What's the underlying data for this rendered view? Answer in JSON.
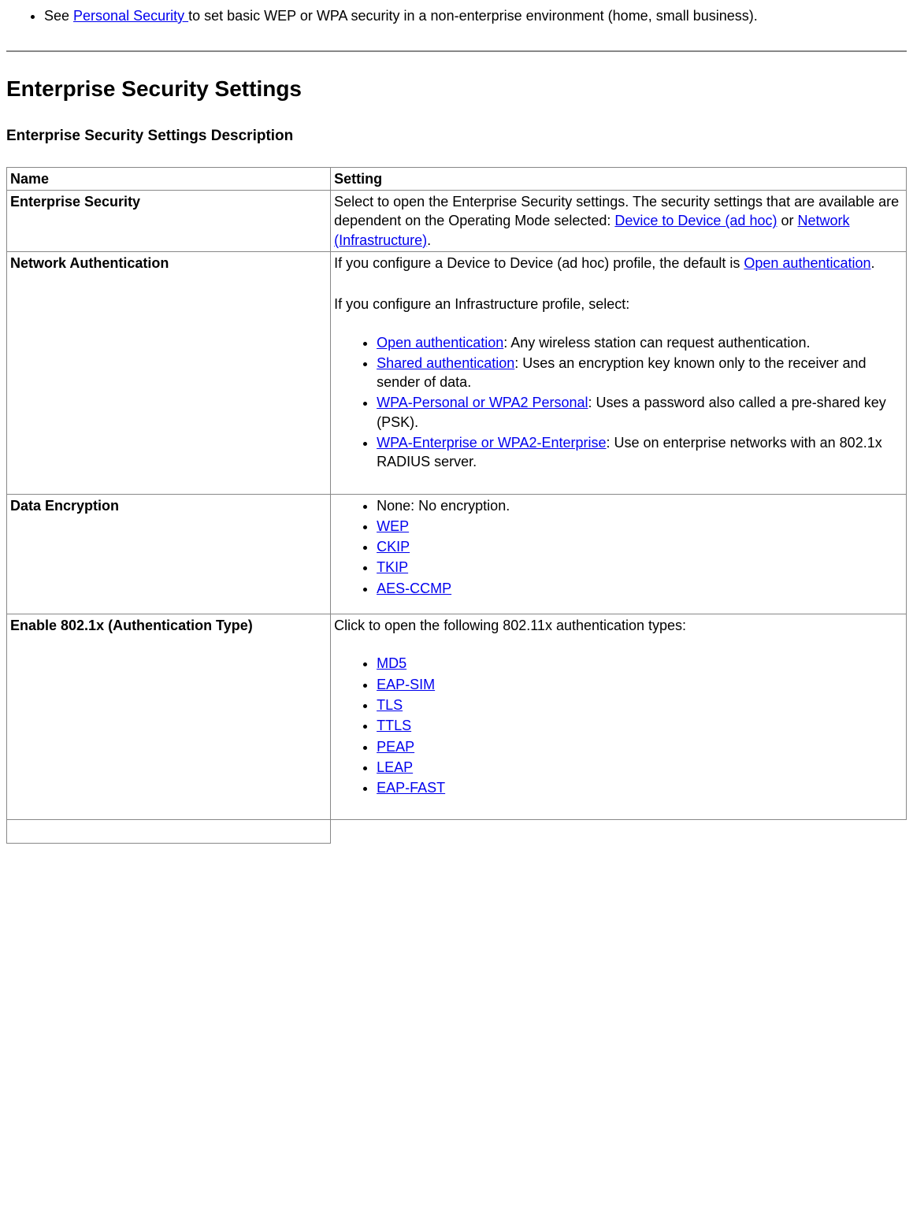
{
  "top_note": {
    "prefix": "See ",
    "link": "Personal Security ",
    "suffix": "to set basic WEP or WPA security in a non-enterprise environment (home, small business)."
  },
  "heading": "Enterprise Security Settings",
  "subheading": "Enterprise Security Settings Description",
  "table": {
    "headers": {
      "name": "Name",
      "setting": "Setting"
    },
    "rows": {
      "r1": {
        "name": "Enterprise Security",
        "setting_parts": {
          "p1a": "Select to open the Enterprise Security settings. The security settings that are available are dependent on the Operating Mode selected: ",
          "link1": "Device to Device (ad hoc)",
          "p1b": " or ",
          "link2": "Network (Infrastructure)",
          "p1c": "."
        }
      },
      "r2": {
        "name": "Network Authentication",
        "intro1a": "If you configure a Device to Device (ad hoc) profile, the default is ",
        "intro1_link": "Open authentication",
        "intro1b": ".",
        "intro2": "If you configure an Infrastructure profile, select:",
        "items": {
          "i1": {
            "link": "Open authentication",
            "suffix": ": Any wireless station can request authentication."
          },
          "i2": {
            "link": "Shared authentication",
            "suffix": ": Uses an encryption key known only to the receiver and sender of data."
          },
          "i3": {
            "link": "WPA-Personal or WPA2 Personal",
            "suffix": ": Uses a password also called a pre-shared key (PSK)."
          },
          "i4": {
            "link": "WPA-Enterprise or WPA2-Enterprise",
            "suffix": ": Use on enterprise networks with an 802.1x RADIUS server."
          }
        }
      },
      "r3": {
        "name": "Data Encryption",
        "items": {
          "i1": {
            "text": "None: No encryption."
          },
          "i2": {
            "link": "WEP"
          },
          "i3": {
            "link": "CKIP"
          },
          "i4": {
            "link": "TKIP"
          },
          "i5": {
            "link": "AES-CCMP"
          }
        }
      },
      "r4": {
        "name": "Enable 802.1x (Authentication Type)",
        "intro": "Click to open the following 802.11x authentication types:",
        "items": {
          "i1": {
            "link": "MD5"
          },
          "i2": {
            "link": "EAP-SIM"
          },
          "i3": {
            "link": "TLS"
          },
          "i4": {
            "link": "TTLS"
          },
          "i5": {
            "link": "PEAP"
          },
          "i6": {
            "link": "LEAP"
          },
          "i7": {
            "link": "EAP-FAST"
          }
        }
      }
    }
  }
}
